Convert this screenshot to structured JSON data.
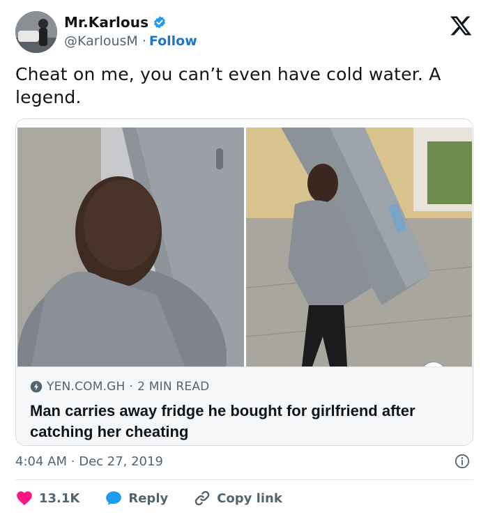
{
  "author": {
    "display_name": "Mr.Karlous",
    "handle": "@KarlousM",
    "separator": "·",
    "follow_label": "Follow",
    "verified": true
  },
  "tweet": {
    "text": "Cheat on me, you can’t even have cold water. A legend."
  },
  "card": {
    "source": "YEN.COM.GH",
    "read_time": "2 MIN READ",
    "source_separator": "·",
    "headline": "Man carries away fridge he bought for girlfriend after catching her cheating"
  },
  "meta": {
    "time": "4:04 AM",
    "separator": "·",
    "date": "Dec 27, 2019"
  },
  "actions": {
    "like_count": "13.1K",
    "reply_label": "Reply",
    "copy_link_label": "Copy link"
  },
  "colors": {
    "accent": "#1d9bf0",
    "like": "#f91880",
    "follow": "#1d76c9",
    "muted": "#536471"
  },
  "icons": {
    "verified": "verified-badge-icon",
    "platform": "x-logo-icon",
    "link": "link-icon",
    "info": "info-icon",
    "like": "heart-icon",
    "reply": "reply-bubble-icon",
    "copy": "chain-link-icon"
  }
}
